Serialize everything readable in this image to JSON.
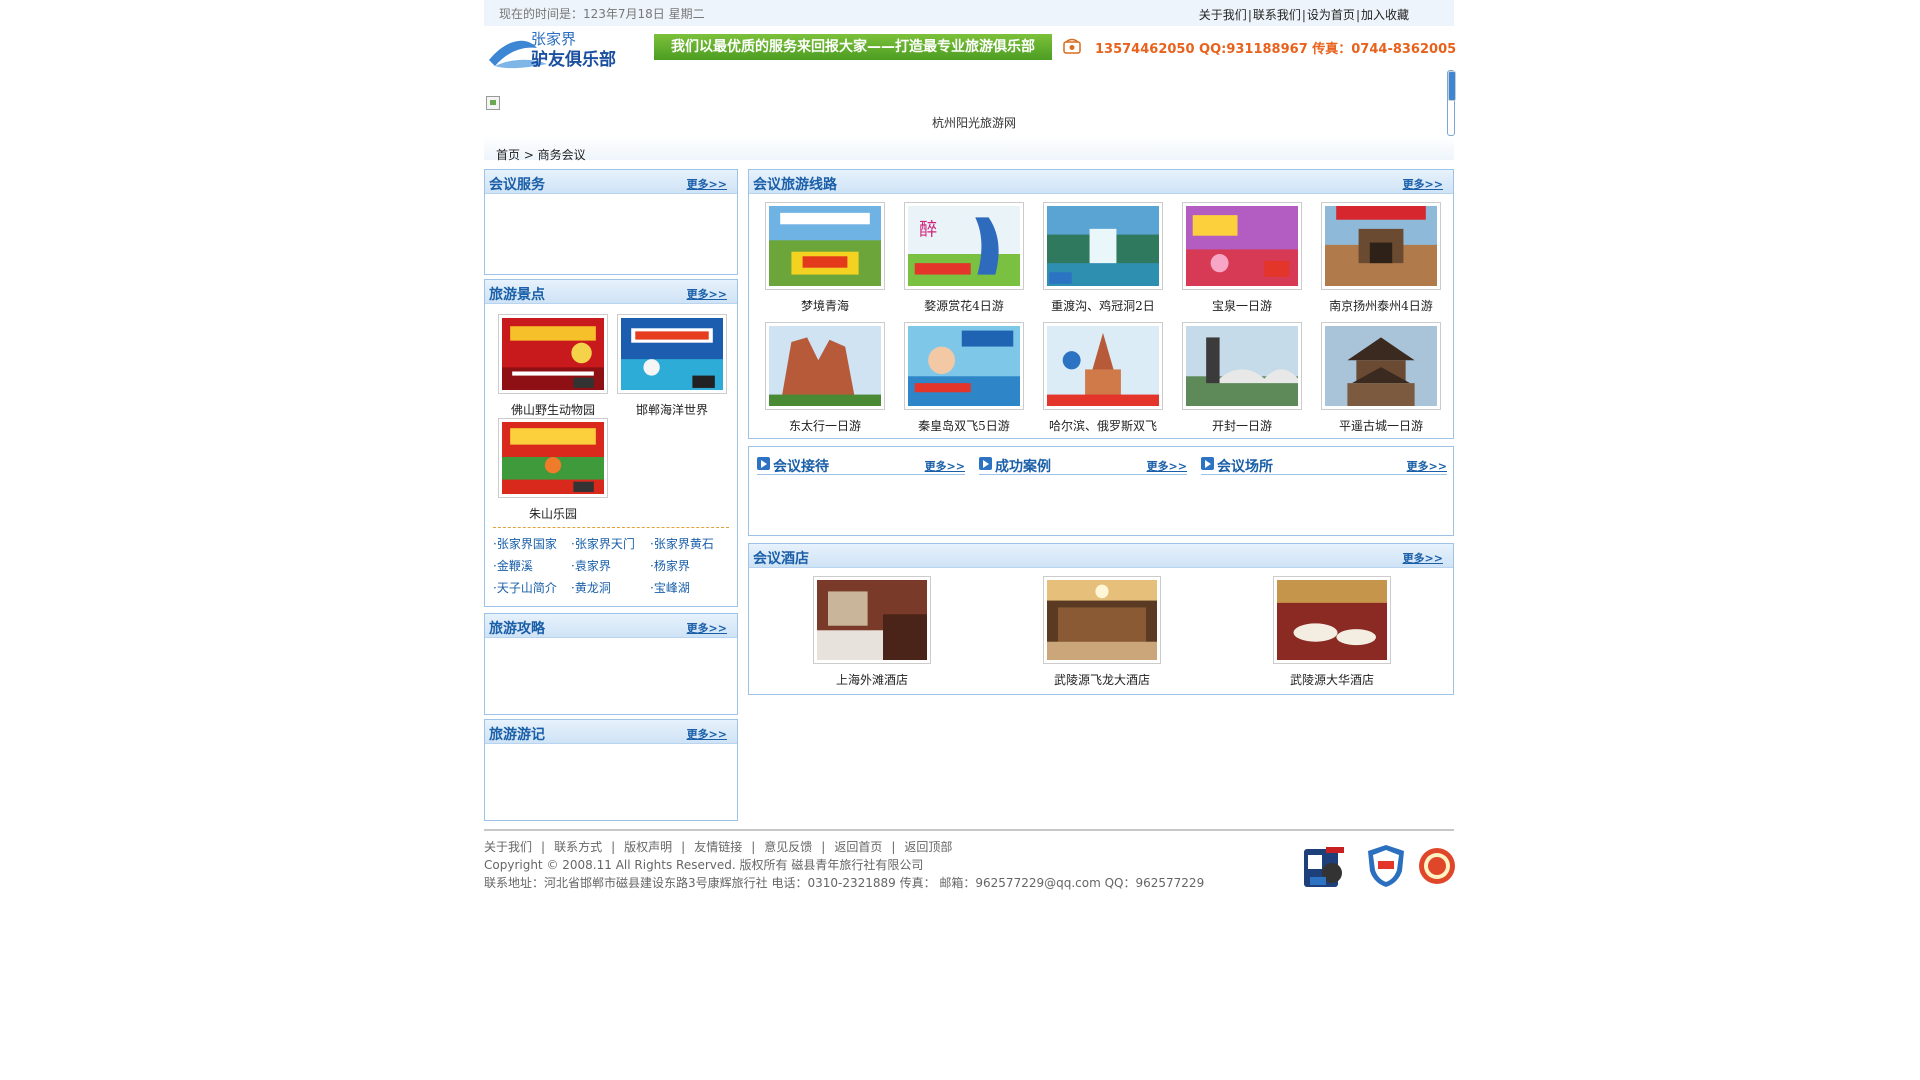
{
  "topbar": {
    "time_text": "现在的时间是：123年7月18日 星期二",
    "links": [
      "关于我们",
      "联系我们",
      "设为首页",
      "加入收藏"
    ]
  },
  "header": {
    "logo_top": "张家界",
    "logo_bottom": "驴友俱乐部",
    "slogan": "我们以最优质的服务来回报大家——打造最专业旅游俱乐部",
    "contact": "13574462050  QQ:931188967 传真：0744-8362005"
  },
  "banner": {
    "caption": "杭州阳光旅游网"
  },
  "breadcrumb": "首页 > 商务会议",
  "more_label": "更多>>",
  "left": {
    "meeting_service": {
      "title": "会议服务"
    },
    "scenic": {
      "title": "旅游景点",
      "items": [
        {
          "name": "佛山野生动物园"
        },
        {
          "name": "邯郸海洋世界"
        },
        {
          "name": "朱山乐园"
        }
      ],
      "links": [
        "·张家界国家",
        "·张家界天门",
        "·张家界黄石",
        "·金鞭溪",
        "·袁家界",
        "·杨家界",
        "·天子山简介",
        "·黄龙洞",
        "·宝峰湖"
      ]
    },
    "guide": {
      "title": "旅游攻略"
    },
    "notes": {
      "title": "旅游游记"
    }
  },
  "routes": {
    "title": "会议旅游线路",
    "items": [
      {
        "name": "梦境青海"
      },
      {
        "name": "婺源赏花4日游"
      },
      {
        "name": "重渡沟、鸡冠洞2日"
      },
      {
        "name": "宝泉一日游"
      },
      {
        "name": "南京扬州泰州4日游"
      },
      {
        "name": "东太行一日游"
      },
      {
        "name": "秦皇岛双飞5日游"
      },
      {
        "name": "哈尔滨、俄罗斯双飞"
      },
      {
        "name": "开封一日游"
      },
      {
        "name": "平遥古城一日游"
      }
    ]
  },
  "subsections": [
    {
      "title": "会议接待"
    },
    {
      "title": "成功案例"
    },
    {
      "title": "会议场所"
    }
  ],
  "hotels": {
    "title": "会议酒店",
    "items": [
      {
        "name": "上海外滩酒店"
      },
      {
        "name": "武陵源飞龙大酒店"
      },
      {
        "name": "武陵源大华酒店"
      }
    ]
  },
  "footer": {
    "nav": [
      "关于我们",
      "联系方式",
      "版权声明",
      "友情链接",
      "意见反馈",
      "返回首页",
      "返回顶部"
    ],
    "copyright": "Copyright © 2008.11   All Rights Reserved.  版权所有  磁县青年旅行社有限公司",
    "address": "联系地址：河北省邯郸市磁县建设东路3号康辉旅行社  电话：0310-2321889  传真：   邮箱：962577229@qq.com  QQ：962577229"
  },
  "colors": {
    "accent": "#1a5fa8",
    "panel_border": "#9fc3e6",
    "slogan_green": "#5aa82a",
    "contact_orange": "#e8621c"
  }
}
